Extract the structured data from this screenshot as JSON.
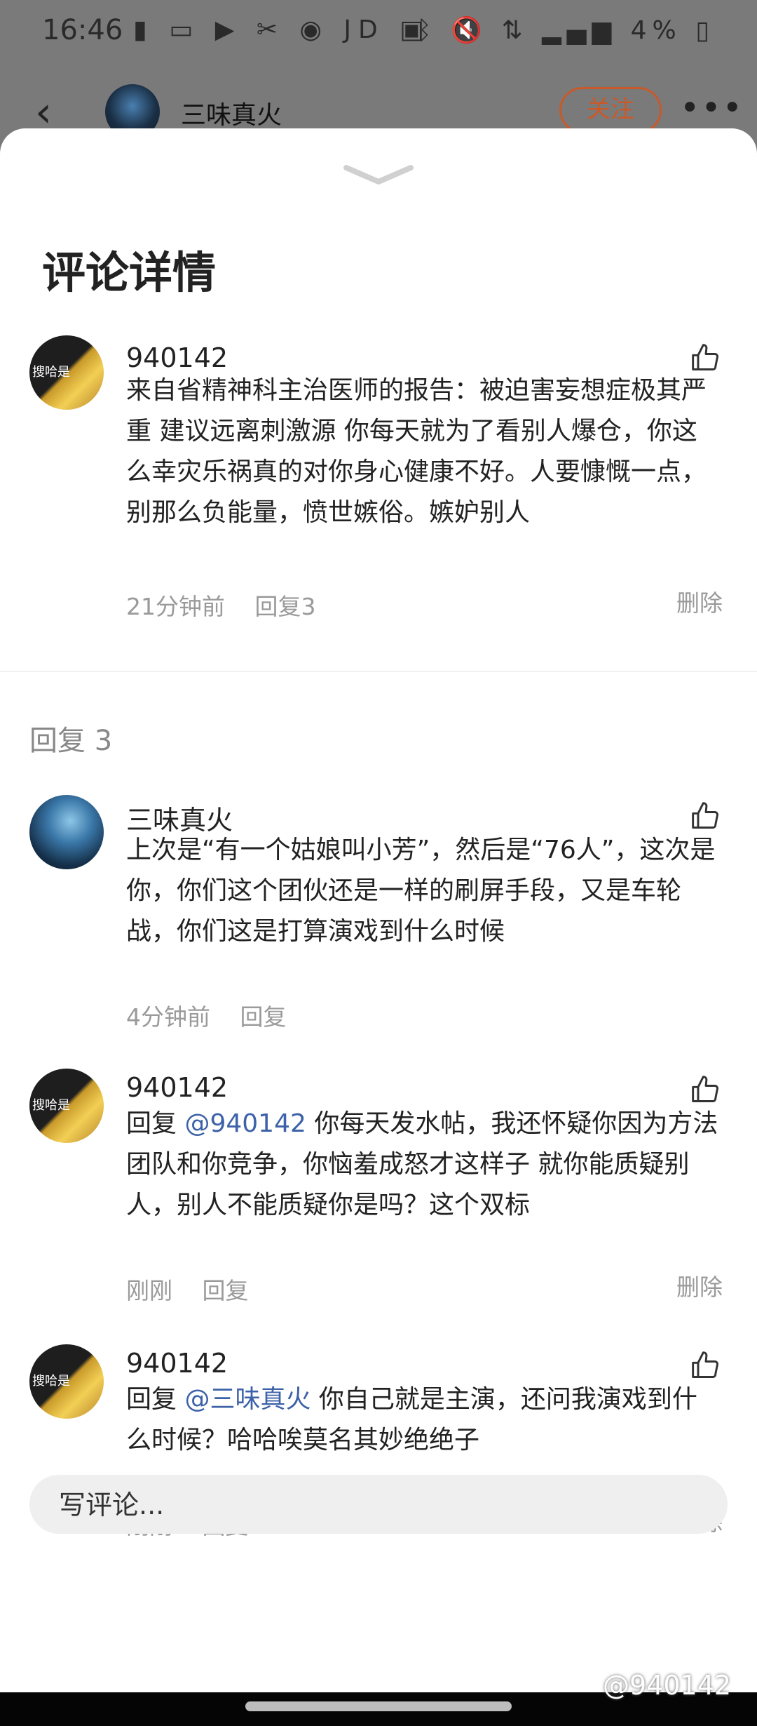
{
  "status_bar": {
    "time": "16:46",
    "left_icons": [
      "battery-alert-icon",
      "message-icon",
      "youtube-icon",
      "scissors-icon",
      "browser-icon",
      "JD",
      "image-icon"
    ],
    "right_icons": [
      "bluetooth-icon",
      "mute-icon",
      "lte-icon",
      "signal-icon"
    ],
    "battery": "4%"
  },
  "background_header": {
    "back_icon": "chevron-left-icon",
    "username": "三味真火",
    "follow_label": "关注",
    "more_icon": "more-icon"
  },
  "sheet": {
    "collapse_icon": "chevron-down-icon",
    "title": "评论详情",
    "main_comment": {
      "avatar_text": "搜哈是",
      "username": "940142",
      "text": "来自省精神科主治医师的报告：被迫害妄想症极其严重 建议远离刺激源 你每天就为了看别人爆仓，你这么幸灾乐祸真的对你身心健康不好。人要慷慨一点，别那么负能量，愤世嫉俗。嫉妒别人",
      "time": "21分钟前",
      "reply_label": "回复3",
      "delete_label": "删除"
    },
    "replies_header": "回复 3",
    "replies": [
      {
        "username": "三味真火",
        "text": "上次是“有一个姑娘叫小芳”，然后是“76人”，这次是你，你们这个团伙还是一样的刷屏手段，又是车轮战，你们这是打算演戏到什么时候",
        "time": "4分钟前",
        "reply_label": "回复"
      },
      {
        "avatar_text": "搜哈是",
        "username": "940142",
        "prefix": "回复 ",
        "mention": "@940142",
        "text": " 你每天发水帖，我还怀疑你因为方法团队和你竞争，你恼羞成怒才这样子 就你能质疑别人，别人不能质疑你是吗？这个双标",
        "time": "刚刚",
        "reply_label": "回复",
        "delete_label": "删除"
      },
      {
        "avatar_text": "搜哈是",
        "username": "940142",
        "prefix": "回复 ",
        "mention": "@三味真火",
        "text": " 你自己就是主演，还问我演戏到什么时候？哈哈唉莫名其妙绝绝子",
        "time": "刚刚",
        "reply_label": "回复",
        "delete_label": "删除"
      }
    ],
    "compose_placeholder": "写评论..."
  },
  "watermark": "@940142"
}
